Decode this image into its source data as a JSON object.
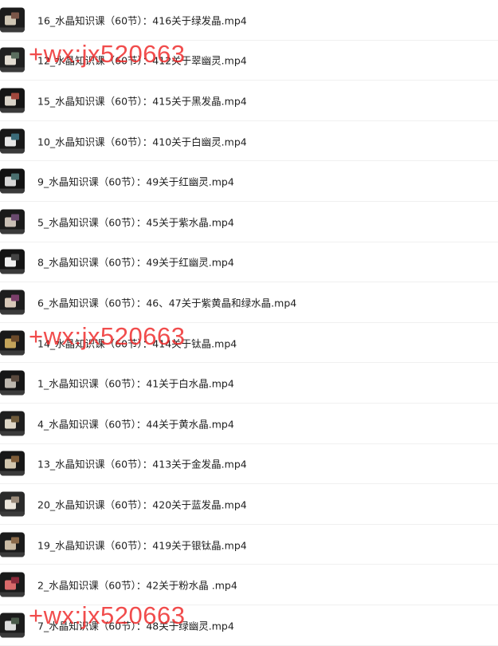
{
  "files": [
    {
      "name": "16_水晶知识课（60节）：416关于绿发晶.mp4",
      "thumb": [
        "#1c1c1c",
        "#cfc6b4",
        "#7a5648"
      ]
    },
    {
      "name": "12_水晶知识课（60节）：412关于翠幽灵.mp4",
      "thumb": [
        "#202020",
        "#e3ddd2",
        "#5b6d5e"
      ]
    },
    {
      "name": "15_水晶知识课（60节）：415关于黑发晶.mp4",
      "thumb": [
        "#151515",
        "#d9d3c8",
        "#a0473c"
      ]
    },
    {
      "name": "10_水晶知识课（60节）：410关于白幽灵.mp4",
      "thumb": [
        "#181818",
        "#e6e6e6",
        "#3b6b79"
      ]
    },
    {
      "name": "9_水晶知识课（60节）：49关于红幽灵.mp4",
      "thumb": [
        "#121212",
        "#d6d6d6",
        "#4a6f6f"
      ]
    },
    {
      "name": "5_水晶知识课（60节）：45关于紫水晶.mp4",
      "thumb": [
        "#1a1a1a",
        "#c9bfb5",
        "#6a4a6e"
      ]
    },
    {
      "name": "8_水晶知识课（60节）：49关于红幽灵.mp4",
      "thumb": [
        "#141414",
        "#efefef",
        "#444444"
      ]
    },
    {
      "name": "6_水晶知识课（60节）：46、47关于紫黄晶和绿水晶.mp4",
      "thumb": [
        "#1d1d1d",
        "#d8c8b8",
        "#7b3f6a"
      ]
    },
    {
      "name": "14_水晶知识课（60节）：414关于钛晶.mp4",
      "thumb": [
        "#191919",
        "#c4a45a",
        "#6b4a2a"
      ]
    },
    {
      "name": "1_水晶知识课（60节）：41关于白水晶.mp4",
      "thumb": [
        "#161616",
        "#bdb7ae",
        "#5a4a3e"
      ]
    },
    {
      "name": "4_水晶知识课（60节）：44关于黄水晶.mp4",
      "thumb": [
        "#1e1e1e",
        "#ded6c6",
        "#6e5a3a"
      ]
    },
    {
      "name": "13_水晶知识课（60节）：413关于金发晶.mp4",
      "thumb": [
        "#171717",
        "#d2c6ae",
        "#7e5c38"
      ]
    },
    {
      "name": "20_水晶知识课（60节）：420关于蓝发晶.mp4",
      "thumb": [
        "#2a2a2a",
        "#ece6dc",
        "#9a8a7a"
      ]
    },
    {
      "name": "19_水晶知识课（60节）：419关于银钛晶.mp4",
      "thumb": [
        "#1b1b1b",
        "#cabba4",
        "#8a6a4a"
      ]
    },
    {
      "name": "2_水晶知识课（60节）：42关于粉水晶 .mp4",
      "thumb": [
        "#1a1a1a",
        "#d86a6a",
        "#8a2a3a"
      ]
    },
    {
      "name": "7_水晶知识课（60节）：48关于绿幽灵.mp4",
      "thumb": [
        "#1c1c1c",
        "#dcdcdc",
        "#4a5a4a"
      ]
    }
  ],
  "watermark": {
    "text": "+wx:jx520663",
    "color": "#ee2424"
  }
}
